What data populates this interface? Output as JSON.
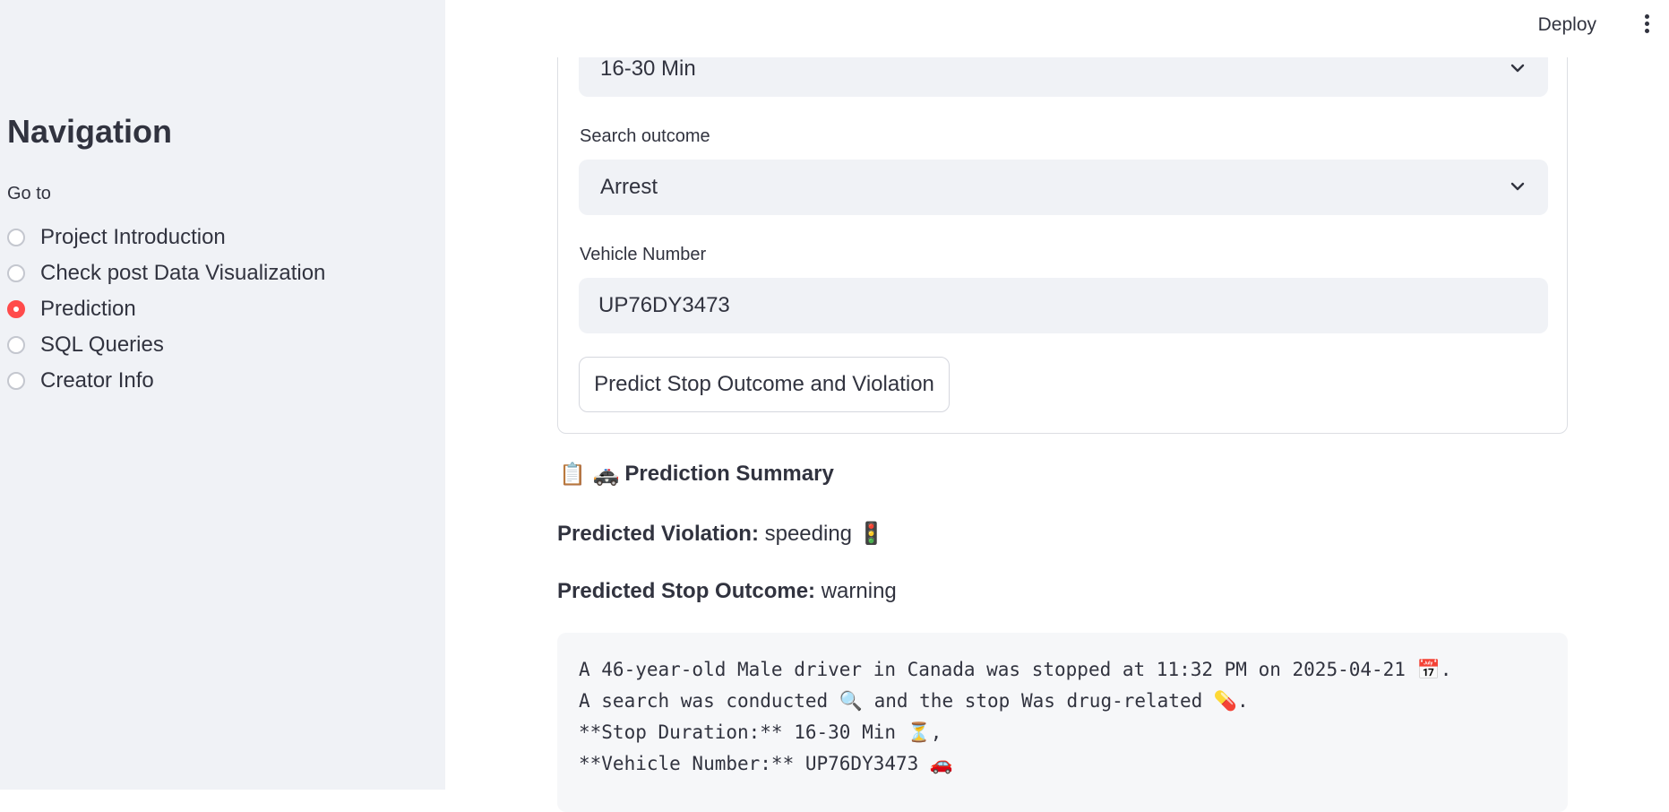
{
  "header": {
    "deploy_label": "Deploy"
  },
  "sidebar": {
    "title": "Navigation",
    "goto_label": "Go to",
    "options": [
      {
        "label": "Project Introduction",
        "selected": false
      },
      {
        "label": "Check post Data Visualization",
        "selected": false
      },
      {
        "label": "Prediction",
        "selected": true
      },
      {
        "label": "SQL Queries",
        "selected": false
      },
      {
        "label": "Creator Info",
        "selected": false
      }
    ]
  },
  "form": {
    "stop_duration_value": "16-30 Min",
    "search_outcome_label": "Search outcome",
    "search_outcome_value": "Arrest",
    "vehicle_number_label": "Vehicle Number",
    "vehicle_number_value": "UP76DY3473",
    "predict_button_label": "Predict Stop Outcome and Violation"
  },
  "summary": {
    "heading_icons": "📋 🚓",
    "heading": "Prediction Summary",
    "violation_label": "Predicted Violation:",
    "violation_value": "speeding",
    "violation_icon": "🚦",
    "outcome_label": "Predicted Stop Outcome:",
    "outcome_value": "warning",
    "code_lines": [
      "A 46-year-old Male driver in Canada was stopped at 11:32 PM on 2025-04-21 📅.",
      "A search was conducted 🔍 and the stop Was drug-related 💊.",
      "**Stop Duration:** 16-30 Min ⏳,",
      "**Vehicle Number:** UP76DY3473 🚗"
    ]
  },
  "colors": {
    "accent": "#ff4b4b",
    "sidebar_bg": "#f0f2f6",
    "input_bg": "#f0f2f6",
    "text": "#31333f",
    "code_bg": "#f6f7f9"
  }
}
